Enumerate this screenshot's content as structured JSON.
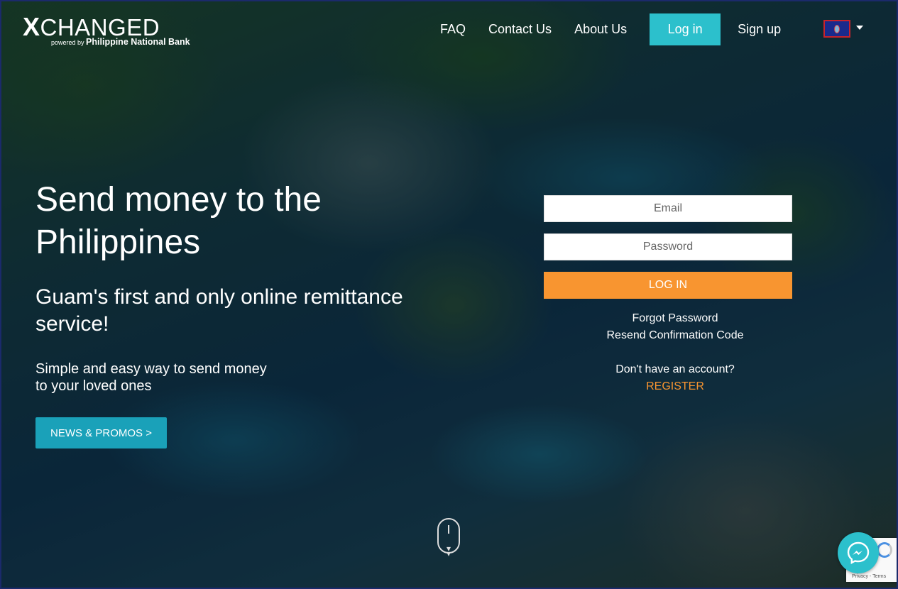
{
  "brand": {
    "name_first_letter": "X",
    "name_rest": "CHANGED",
    "powered_by": "powered by",
    "bank": "Philippine National Bank"
  },
  "nav": {
    "faq": "FAQ",
    "contact": "Contact Us",
    "about": "About Us",
    "login": "Log in",
    "signup": "Sign up",
    "flag_icon": "guam-flag-icon",
    "accent": "#2cc0cc"
  },
  "hero": {
    "headline": "Send money to the Philippines",
    "subhead": "Guam's first and only online remittance service!",
    "tagline_line1": "Simple and easy way to send money",
    "tagline_line2": "to your loved ones",
    "news_button": "NEWS & PROMOS >"
  },
  "login": {
    "email_placeholder": "Email",
    "password_placeholder": "Password",
    "submit": "LOG IN",
    "submit_color": "#f89530",
    "forgot": "Forgot Password",
    "resend": "Resend Confirmation Code",
    "no_account": "Don't have an account?",
    "register": "REGISTER"
  },
  "widgets": {
    "recaptcha_privacy": "Privacy",
    "recaptcha_sep": "-",
    "recaptcha_terms": "Terms",
    "messenger_icon": "messenger-icon",
    "scroll_icon": "scroll-down-mouse-icon"
  }
}
